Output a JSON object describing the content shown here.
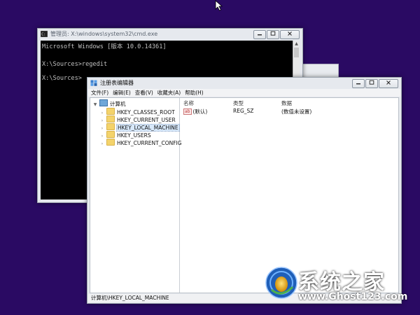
{
  "desktop": {
    "background": "#2a0a63"
  },
  "cmd": {
    "title": "管理员: X:\\windows\\system32\\cmd.exe",
    "lines": [
      "Microsoft Windows [版本 10.0.14361]",
      "",
      "X:\\Sources>regedit",
      "",
      "X:\\Sources>"
    ]
  },
  "regedit": {
    "title": "注册表编辑器",
    "menu": [
      "文件(F)",
      "编辑(E)",
      "查看(V)",
      "收藏夹(A)",
      "帮助(H)"
    ],
    "tree": {
      "root": "计算机",
      "children": [
        "HKEY_CLASSES_ROOT",
        "HKEY_CURRENT_USER",
        "HKEY_LOCAL_MACHINE",
        "HKEY_USERS",
        "HKEY_CURRENT_CONFIG"
      ],
      "selected": "HKEY_LOCAL_MACHINE"
    },
    "columns": [
      "名称",
      "类型",
      "数据"
    ],
    "rows": [
      {
        "name": "(默认)",
        "type": "REG_SZ",
        "data": "(数值未设置)"
      }
    ],
    "icon_label": "ab",
    "status": "计算机\\HKEY_LOCAL_MACHINE"
  },
  "watermark": {
    "name": "系统之家",
    "url": "www.Ghost123.com"
  }
}
